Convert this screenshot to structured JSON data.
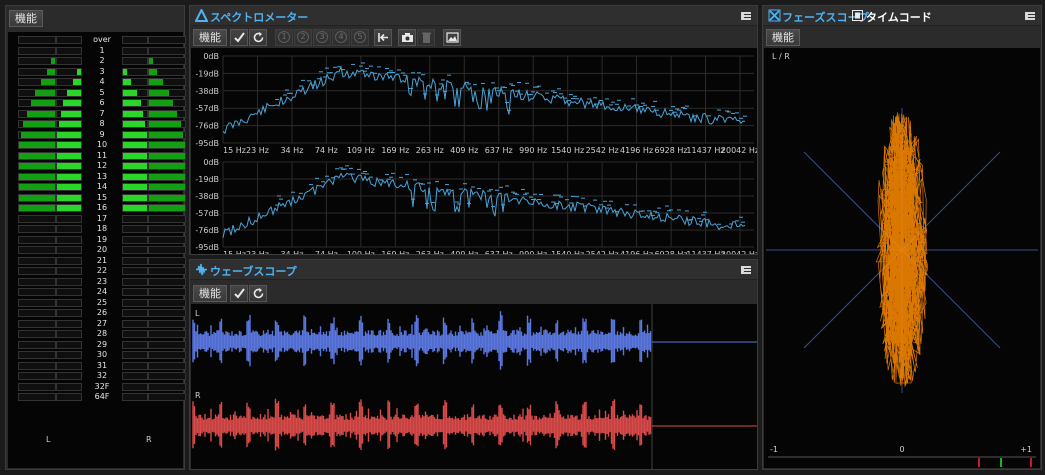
{
  "meter": {
    "function_label": "機能",
    "channels": [
      "L",
      "R"
    ],
    "levels": [
      "over",
      "1",
      "2",
      "3",
      "4",
      "5",
      "6",
      "7",
      "8",
      "9",
      "10",
      "11",
      "12",
      "13",
      "14",
      "15",
      "16",
      "17",
      "18",
      "19",
      "20",
      "21",
      "22",
      "23",
      "24",
      "25",
      "26",
      "27",
      "28",
      "29",
      "30",
      "31",
      "32",
      "32F",
      "64F"
    ]
  },
  "spectrum": {
    "title": "スペクトロメーター",
    "function_label": "機能",
    "preset_numbers": [
      "1",
      "2",
      "3",
      "4",
      "5"
    ],
    "db_ticks": [
      "0dB",
      "-19dB",
      "-38dB",
      "-57dB",
      "-76dB",
      "-95dB"
    ],
    "freq_ticks": [
      "15 Hz",
      "23 Hz",
      "34 Hz",
      "74 Hz",
      "109 Hz",
      "169 Hz",
      "263 Hz",
      "409 Hz",
      "637 Hz",
      "990 Hz",
      "1540 Hz",
      "2542 Hz",
      "4196 Hz",
      "6928 Hz",
      "11437 Hz",
      "20042 Hz"
    ],
    "line_color": "#4aa3d8"
  },
  "wavescope": {
    "title": "ウェーブスコープ",
    "function_label": "機能",
    "channels": [
      "L",
      "R"
    ],
    "colors": {
      "left": "#5a78e0",
      "right": "#d94a4a"
    }
  },
  "phasescope": {
    "tab_active": "フェーズスコープ",
    "tab_other": "タイムコード",
    "function_label": "機能",
    "corner_label": "L / R",
    "axis_labels": [
      "-1",
      "0",
      "+1"
    ],
    "trace_color": "#ff8c00"
  }
}
